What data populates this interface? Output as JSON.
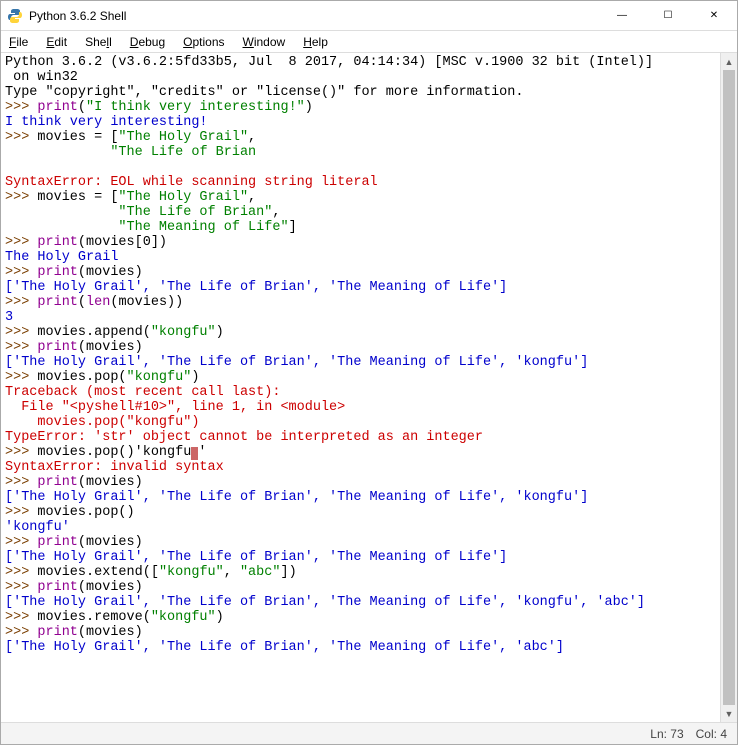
{
  "window": {
    "title": "Python 3.6.2 Shell",
    "min": "—",
    "max": "☐",
    "close": "✕"
  },
  "menu": {
    "file": "File",
    "edit": "Edit",
    "shell": "Shell",
    "debug": "Debug",
    "options": "Options",
    "window": "Window",
    "help": "Help"
  },
  "banner": {
    "line1": "Python 3.6.2 (v3.6.2:5fd33b5, Jul  8 2017, 04:14:34) [MSC v.1900 32 bit (Intel)]",
    "line2": " on win32",
    "line3": "Type \"copyright\", \"credits\" or \"license()\" for more information."
  },
  "prompt": ">>> ",
  "s": {
    "print": "print",
    "len": "len",
    "str_interesting": "\"I think very interesting!\"",
    "out_interesting": "I think very interesting!",
    "movies_assign": "movies = [",
    "holy": "\"The Holy Grail\"",
    "brian_open": "\"The Life of Brian",
    "eol": "SyntaxError: EOL while scanning string literal",
    "brian": "\"The Life of Brian\"",
    "meaning": "\"The Meaning of Life\"",
    "print_m0": "(movies[0])",
    "out_holy": "The Holy Grail",
    "print_movies": "(movies)",
    "list3": "['The Holy Grail', 'The Life of Brian', 'The Meaning of Life']",
    "len_movies": "(movies))",
    "three": "3",
    "append_kongfu": "movies.append(",
    "kongfu": "\"kongfu\"",
    "list4": "['The Holy Grail', 'The Life of Brian', 'The Meaning of Life', 'kongfu']",
    "pop_kongfu": "movies.pop(",
    "tb1": "Traceback (most recent call last):",
    "tb2": "  File \"<pyshell#10>\", line 1, in <module>",
    "tb3": "    movies.pop(\"kongfu\")",
    "tb4": "TypeError: 'str' object cannot be interpreted as an integer",
    "pop_bad": "movies.pop()'kongfu",
    "invalid": "SyntaxError: invalid syntax",
    "pop_empty": "movies.pop()",
    "out_kongfu": "'kongfu'",
    "extend": "movies.extend([",
    "abc": "\"abc\"",
    "list5": "['The Holy Grail', 'The Life of Brian', 'The Meaning of Life', 'kongfu', 'abc']",
    "remove": "movies.remove(",
    "list_final": "['The Holy Grail', 'The Life of Brian', 'The Meaning of Life', 'abc']",
    "comma": ",",
    "comma_sp": ", ",
    "rbrack": "]",
    "rbrack_paren": "])",
    "rparen": ")",
    "lparen": "(",
    "sq": "'"
  },
  "status": {
    "ln": "Ln: 73",
    "col": "Col: 4"
  }
}
